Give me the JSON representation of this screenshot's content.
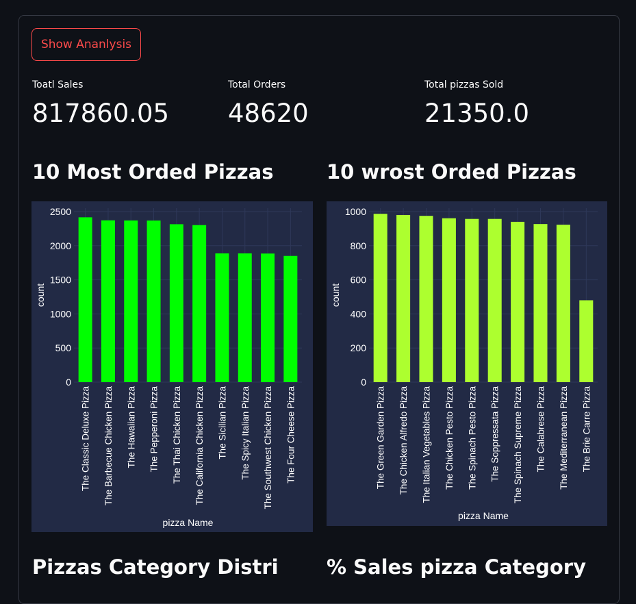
{
  "button": {
    "label": "Show Ananlysis"
  },
  "metrics": [
    {
      "label": "Toatl Sales",
      "value": "817860.05"
    },
    {
      "label": "Total Orders",
      "value": "48620"
    },
    {
      "label": "Total pizzas Sold",
      "value": "21350.0"
    }
  ],
  "headings": {
    "most": "10 Most Orded Pizzas",
    "worst": "10 wrost Orded Pizzas",
    "category": "Pizzas Category Distri",
    "sales": "% Sales pizza Category"
  },
  "chart_data": [
    {
      "type": "bar",
      "title": "",
      "xlabel": "pizza Name",
      "ylabel": "count",
      "ylim": [
        0,
        2550
      ],
      "yticks": [
        0,
        500,
        1000,
        1500,
        2000,
        2500
      ],
      "color": "#00ff00",
      "categories": [
        "The Classic Deluxe Pizza",
        "The Barbecue Chicken Pizza",
        "The Hawaiian Pizza",
        "The Pepperoni Pizza",
        "The Thai Chicken Pizza",
        "The California Chicken Pizza",
        "The Sicilian Pizza",
        "The Spicy Italian Pizza",
        "The Southwest Chicken Pizza",
        "The Four Cheese Pizza"
      ],
      "values": [
        2416,
        2372,
        2370,
        2369,
        2315,
        2302,
        1887,
        1887,
        1885,
        1850
      ]
    },
    {
      "type": "bar",
      "title": "",
      "xlabel": "pizza Name",
      "ylabel": "count",
      "ylim": [
        0,
        1020
      ],
      "yticks": [
        0,
        200,
        400,
        600,
        800,
        1000
      ],
      "color": "#adff2f",
      "categories": [
        "The Green Garden Pizza",
        "The Chicken Alfredo Pizza",
        "The Italian Vegetables Pizza",
        "The Chicken Pesto Pizza",
        "The Spinach Pesto Pizza",
        "The Soppressata Pizza",
        "The Spinach Supreme Pizza",
        "The Calabrese Pizza",
        "The Mediterranean Pizza",
        "The Brie Carre Pizza"
      ],
      "values": [
        987,
        980,
        975,
        961,
        957,
        957,
        940,
        927,
        923,
        480
      ]
    }
  ]
}
